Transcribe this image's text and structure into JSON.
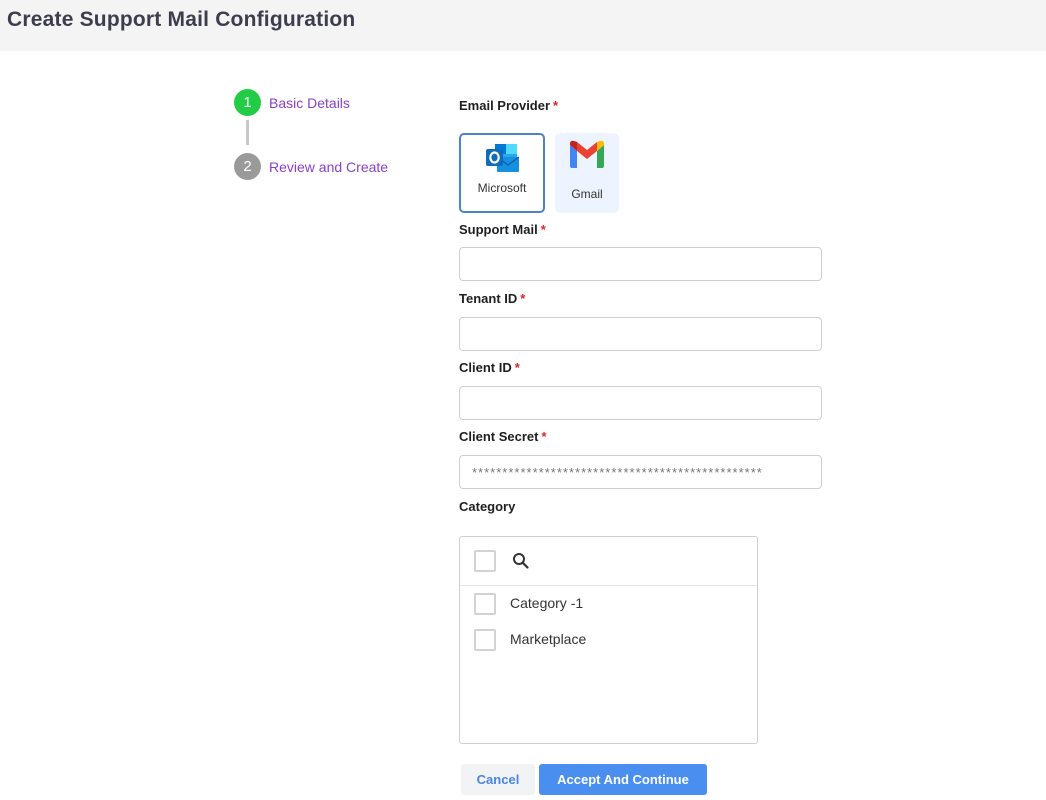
{
  "header": {
    "title": "Create Support Mail Configuration"
  },
  "stepper": {
    "steps": [
      {
        "number": "1",
        "label": "Basic Details",
        "state": "active"
      },
      {
        "number": "2",
        "label": "Review and Create",
        "state": "inactive"
      }
    ]
  },
  "form": {
    "email_provider": {
      "label": "Email Provider",
      "required_mark": "*",
      "options": [
        {
          "label": "Microsoft",
          "icon": "outlook-icon",
          "selected": true
        },
        {
          "label": "Gmail",
          "icon": "gmail-icon",
          "selected": false
        }
      ]
    },
    "support_mail": {
      "label": "Support Mail",
      "required_mark": "*",
      "value": ""
    },
    "tenant_id": {
      "label": "Tenant ID",
      "required_mark": "*",
      "value": ""
    },
    "client_id": {
      "label": "Client ID",
      "required_mark": "*",
      "value": ""
    },
    "client_secret": {
      "label": "Client Secret",
      "required_mark": "*",
      "value": "************************************************"
    },
    "category": {
      "label": "Category",
      "search_icon": "search-icon",
      "items": [
        {
          "label": "Category -1",
          "checked": false
        },
        {
          "label": "Marketplace",
          "checked": false
        }
      ]
    }
  },
  "actions": {
    "cancel_label": "Cancel",
    "accept_label": "Accept And Continue"
  },
  "colors": {
    "accent": "#4a8ff0",
    "step_active": "#22cc44",
    "step_inactive": "#9a9a9a",
    "step_label": "#8a3fd1",
    "required": "#e02424"
  }
}
